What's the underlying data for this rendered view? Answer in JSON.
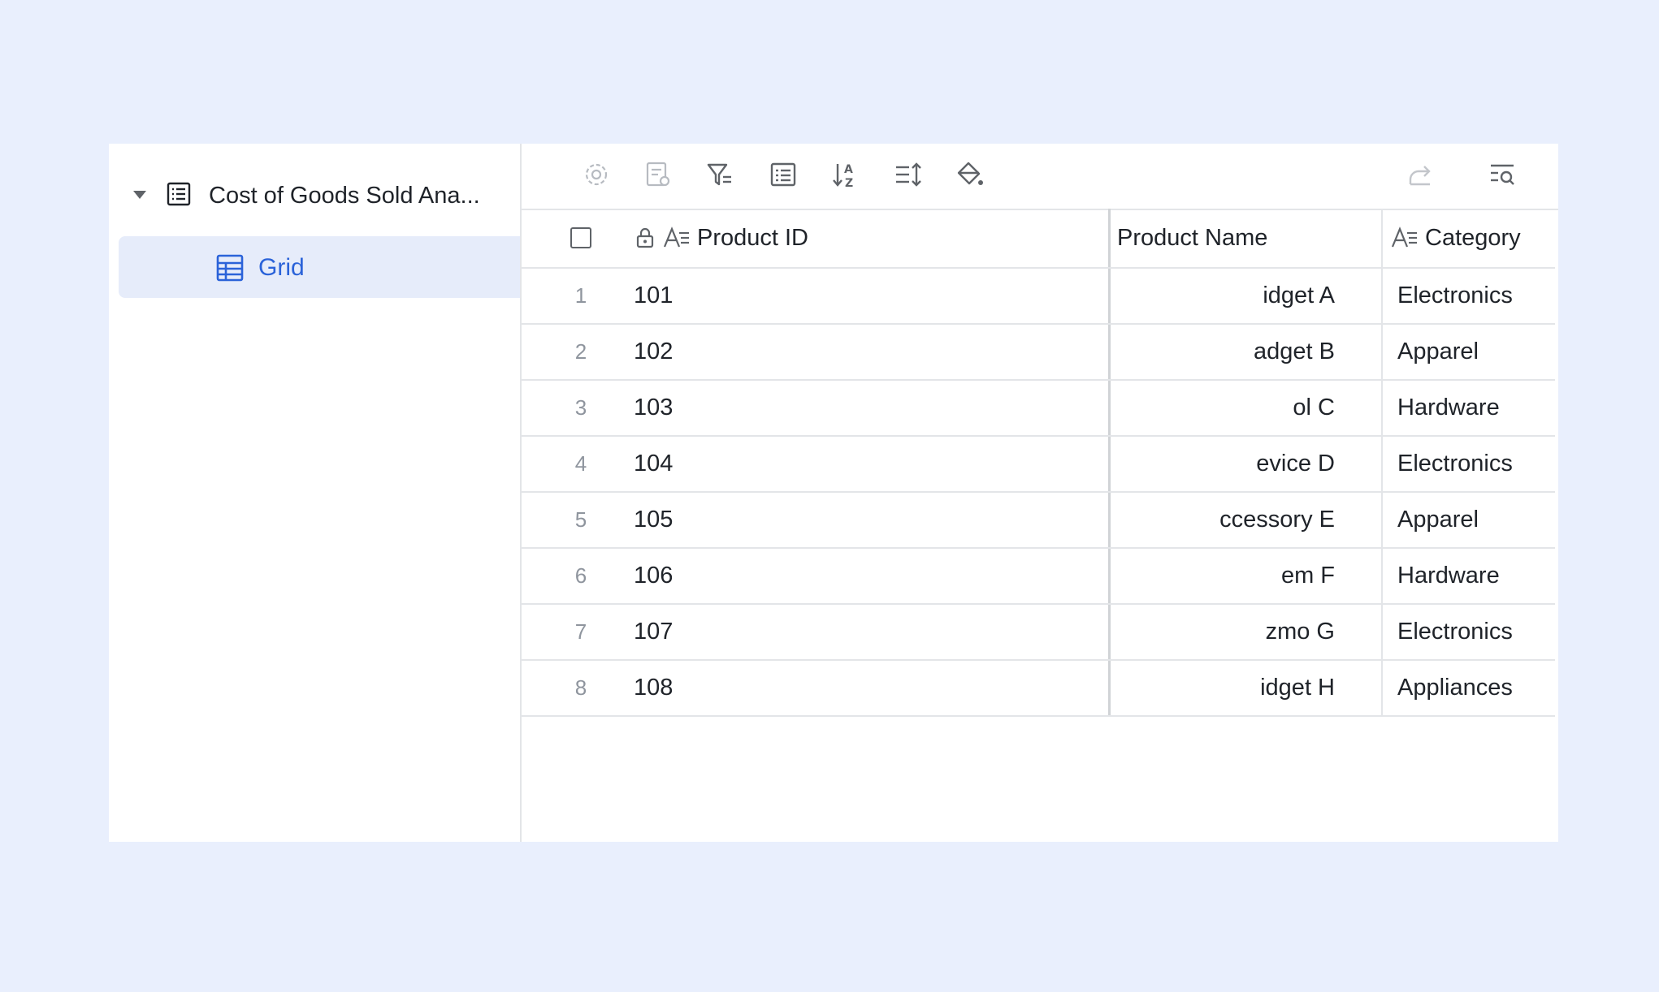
{
  "sidebar": {
    "table_title": "Cost of Goods Sold Ana...",
    "views": [
      {
        "label": "Grid",
        "selected": true
      }
    ]
  },
  "toolbar": {
    "icons": [
      "settings-icon",
      "field-settings-icon",
      "filter-icon",
      "group-icon",
      "sort-icon",
      "row-height-icon",
      "fill-color-icon",
      "share-icon",
      "search-icon"
    ]
  },
  "table": {
    "columns": [
      {
        "label": "Product ID",
        "locked": true,
        "type_icon": "text-type-icon"
      },
      {
        "label": "Product Name"
      },
      {
        "label": "Category",
        "type_icon": "text-type-icon"
      }
    ],
    "rows": [
      {
        "num": "1",
        "id": "101",
        "name": "idget A",
        "category": "Electronics"
      },
      {
        "num": "2",
        "id": "102",
        "name": "adget B",
        "category": "Apparel"
      },
      {
        "num": "3",
        "id": "103",
        "name": "ol C",
        "category": "Hardware"
      },
      {
        "num": "4",
        "id": "104",
        "name": "evice D",
        "category": "Electronics"
      },
      {
        "num": "5",
        "id": "105",
        "name": "ccessory E",
        "category": "Apparel"
      },
      {
        "num": "6",
        "id": "106",
        "name": "em F",
        "category": "Hardware"
      },
      {
        "num": "7",
        "id": "107",
        "name": "zmo G",
        "category": "Electronics"
      },
      {
        "num": "8",
        "id": "108",
        "name": "idget H",
        "category": "Appliances"
      }
    ]
  },
  "colors": {
    "background": "#e9effd",
    "accent": "#2b63d9",
    "selected_bg": "#e6ecfa"
  }
}
